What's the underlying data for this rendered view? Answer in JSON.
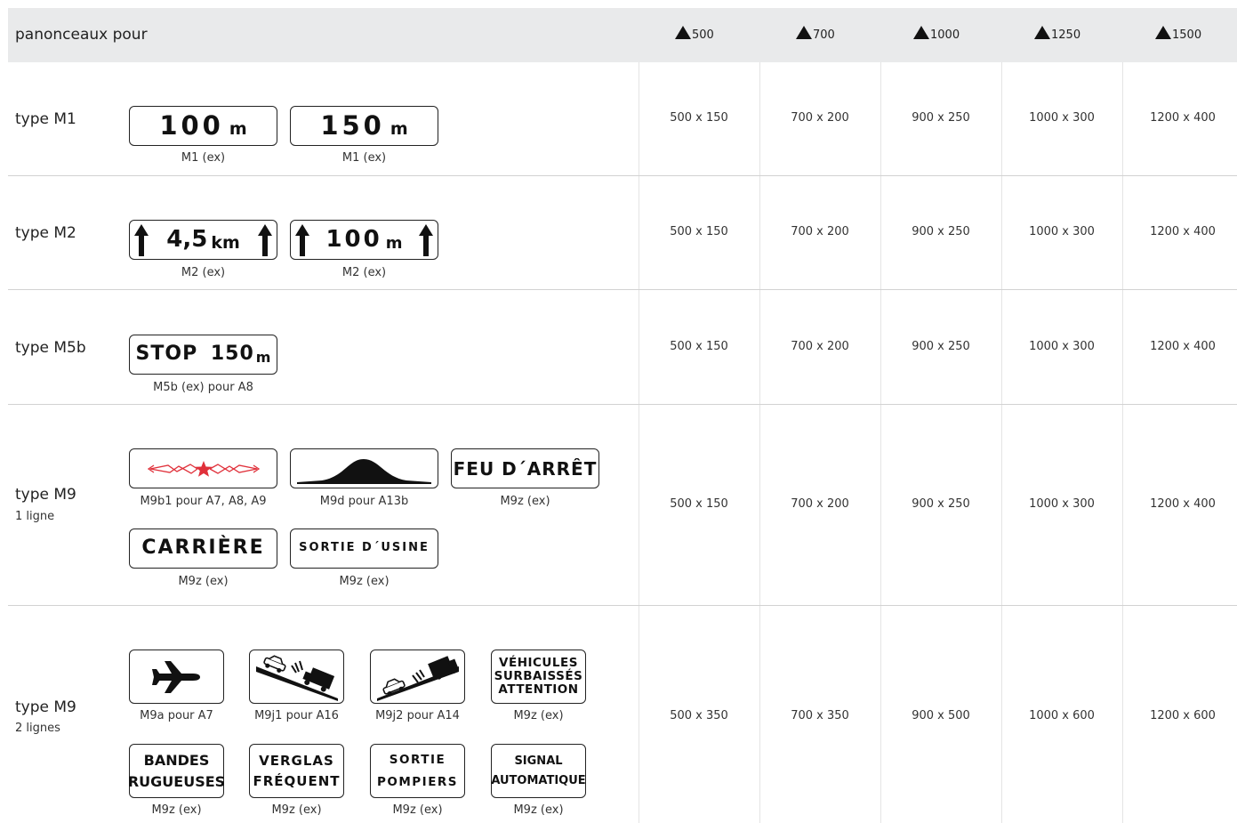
{
  "header": {
    "title": "panonceaux pour",
    "columns": [
      "500",
      "700",
      "1000",
      "1250",
      "1500"
    ]
  },
  "rows": [
    {
      "label": "type M1",
      "sub": "",
      "sizes": [
        "500 x 150",
        "700 x 200",
        "900 x 250",
        "1000 x 300",
        "1200 x 400"
      ],
      "signs": [
        {
          "big": "100",
          "unit": "m",
          "caption": "M1 (ex)"
        },
        {
          "big": "150",
          "unit": "m",
          "caption": "M1 (ex)"
        }
      ]
    },
    {
      "label": "type M2",
      "sub": "",
      "sizes": [
        "500 x 150",
        "700 x 200",
        "900 x 250",
        "1000 x 300",
        "1200 x 400"
      ],
      "signs": [
        {
          "big": "4,5",
          "unit": "km",
          "caption": "M2 (ex)"
        },
        {
          "big": "100",
          "unit": "m",
          "caption": "M2 (ex)"
        }
      ]
    },
    {
      "label": "type M5b",
      "sub": "",
      "sizes": [
        "500 x 150",
        "700 x 200",
        "900 x 250",
        "1000 x 300",
        "1200 x 400"
      ],
      "signs": [
        {
          "big": "STOP 150",
          "unit": "m",
          "caption": "M5b (ex) pour A8"
        }
      ]
    },
    {
      "label": "type M9",
      "sub": "1 ligne",
      "sizes": [
        "500 x 150",
        "700 x 200",
        "900 x 250",
        "1000 x 300",
        "1200 x 400"
      ],
      "signs": [
        {
          "text": "",
          "icon": "electric-hazard-icon",
          "caption": "M9b1 pour A7, A8, A9"
        },
        {
          "text": "",
          "icon": "speed-bump-icon",
          "caption": "M9d pour A13b"
        },
        {
          "text": "FEU D´ARRÊT",
          "caption": "M9z (ex)"
        },
        {
          "text": "CARRIÈRE",
          "caption": "M9z (ex)"
        },
        {
          "text": "SORTIE D´USINE",
          "caption": "M9z (ex)"
        }
      ]
    },
    {
      "label": "type M9",
      "sub": "2 lignes",
      "sizes": [
        "500 x 350",
        "700 x 350",
        "900 x 500",
        "1000 x 600",
        "1200 x 600"
      ],
      "signs": [
        {
          "icon": "airplane-icon",
          "caption": "M9a pour A7"
        },
        {
          "icon": "car-truck-downhill-icon",
          "caption": "M9j1 pour A16"
        },
        {
          "icon": "car-truck-uphill-icon",
          "caption": "M9j2 pour A14"
        },
        {
          "lines": [
            "VÉHICULES",
            "SURBAISSÉS",
            "ATTENTION"
          ],
          "caption": "M9z (ex)"
        },
        {
          "lines": [
            "BANDES",
            "RUGUEUSES"
          ],
          "caption": "M9z (ex)"
        },
        {
          "lines": [
            "VERGLAS",
            "FRÉQUENT"
          ],
          "caption": "M9z (ex)"
        },
        {
          "lines": [
            "SORTIE",
            "POMPIERS"
          ],
          "caption": "M9z (ex)"
        },
        {
          "lines": [
            "SIGNAL",
            "AUTOMATIQUE"
          ],
          "caption": "M9z (ex)"
        }
      ]
    }
  ]
}
